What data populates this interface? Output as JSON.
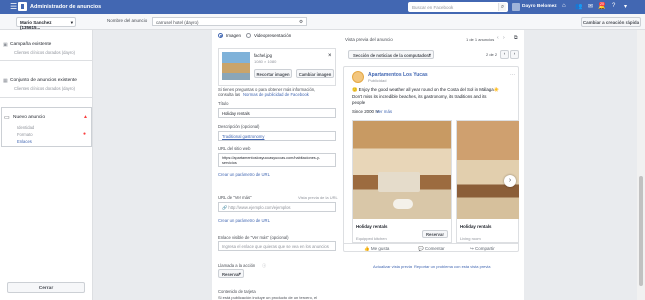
{
  "topbar": {
    "menu_glyph": "☰",
    "title": "Administrador de anuncios",
    "search_placeholder": "Buscar en Facebook",
    "user_name": "Dayro Belomez",
    "home_glyph": "⌂",
    "notif_count": "20"
  },
  "subbar": {
    "account_dropdown": "Mario Sanchez (135615...",
    "ad_name_label": "Nombre del anuncio",
    "ad_name_value": "carrusel hotel (dayro)",
    "discard_button": "Cambiar a creación rápida"
  },
  "sidebar": {
    "campaign_title": "Campaña existente",
    "campaign_sub": "Clientes clínicos dorados (dayro)",
    "adset_title": "Conjunto de anuncios existente",
    "adset_sub": "Clientes clínicos dorados (dayro)",
    "ad_title": "Nuevo anuncio",
    "ad_items": [
      "Identidad",
      "Formato",
      "Enlaces"
    ],
    "close_button": "Cerrar"
  },
  "form": {
    "radio_image": "Imagen",
    "radio_slideshow": "Videopresentación",
    "file_name": "fachel.jpg",
    "file_dims": "1080 × 1080",
    "change_image_button": "Recortar imagen",
    "add_image_button": "Cambiar imagen",
    "help_text_1": "Si tienes preguntas o para obtener más información,",
    "help_text_2": "consulta las",
    "help_link": "Normas de publicidad de Facebook",
    "title_label": "Título",
    "title_value": "Holiday rentals",
    "desc_label": "Descripción (opcional)",
    "desc_value": "Traditional gastronomy",
    "url_label": "URL del sitio web",
    "url_value": "https://apartamentoslosyuccasyuccas.com/habitaciones-y-servicios",
    "url_param_link": "Crear un parámetro de URL",
    "seemore_label": "URL de \"Ver más\"",
    "seemore_preview_link": "Vista previa de la URL",
    "seemore_placeholder": "http://www.ejemplo.com/ejemplos",
    "seemore_param_link": "Crear un parámetro de URL",
    "seemore_domain_label": "Enlace visible de \"Ver más\" (opcional)",
    "seemore_domain_help": "Ingresa el enlace que quieras que se vea en los anuncios",
    "cta_label": "Llamada a la acción",
    "cta_value": "Reservar",
    "slide_content_label": "Contenido de tarjeta",
    "slide_content_help": "Si está publicación incluye un producto de un tercero, el"
  },
  "preview": {
    "header": "Vista previa del anuncio",
    "counter": "1 de 1 anuncios",
    "placement_dropdown": "Sección de noticias de la computadora",
    "page_counter": "2 de 2",
    "page_name": "Apartamentos Los Yucas",
    "sponsored": "Publicidad",
    "body_1": "🙂 Enjoy the good weather all year round on the Costa del Sol in Málaga☀️",
    "body_2": "Don't miss its incredible beaches, its gastronomy, its traditions and its",
    "body_3": "people",
    "since": "Since 2000 ✉",
    "see_more": "Ver más",
    "cards": [
      {
        "title": "Holiday rentals",
        "desc": "Equipped kitchen",
        "cta": "Reservar"
      },
      {
        "title": "Holiday rentals",
        "desc": "Living room",
        "cta": ""
      }
    ],
    "actions": [
      "Me gusta",
      "Comentar",
      "Compartir"
    ],
    "footer_link_1": "Actualizar vista previa",
    "footer_link_2": "Reportar un problema con esta vista previa"
  }
}
